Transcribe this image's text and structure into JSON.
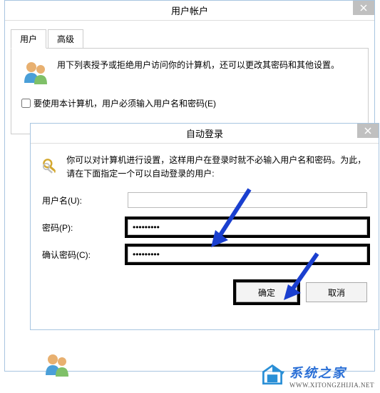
{
  "window1": {
    "title": "用户帐户",
    "tabs": {
      "user": "用户",
      "advanced": "高级"
    },
    "infoText": "用下列表授予或拒绝用户访问你的计算机，还可以更改其密码和其他设置。",
    "checkboxLabel": "要使用本计算机，用户必须输入用户名和密码(E)"
  },
  "window2": {
    "title": "自动登录",
    "infoText": "你可以对计算机进行设置，这样用户在登录时就不必输入用户名和密码。为此，请在下面指定一个可以自动登录的用户:",
    "usernameLabel": "用户名(U):",
    "usernameValue": "",
    "passwordLabel": "密码(P):",
    "passwordValue": "•••••••••",
    "confirmLabel": "确认密码(C):",
    "confirmValue": "•••••••••",
    "okButton": "确定",
    "cancelButton": "取消"
  },
  "watermark": {
    "cn": "系统之家",
    "en": "WWW.XITONGZHIJIA.NET"
  }
}
